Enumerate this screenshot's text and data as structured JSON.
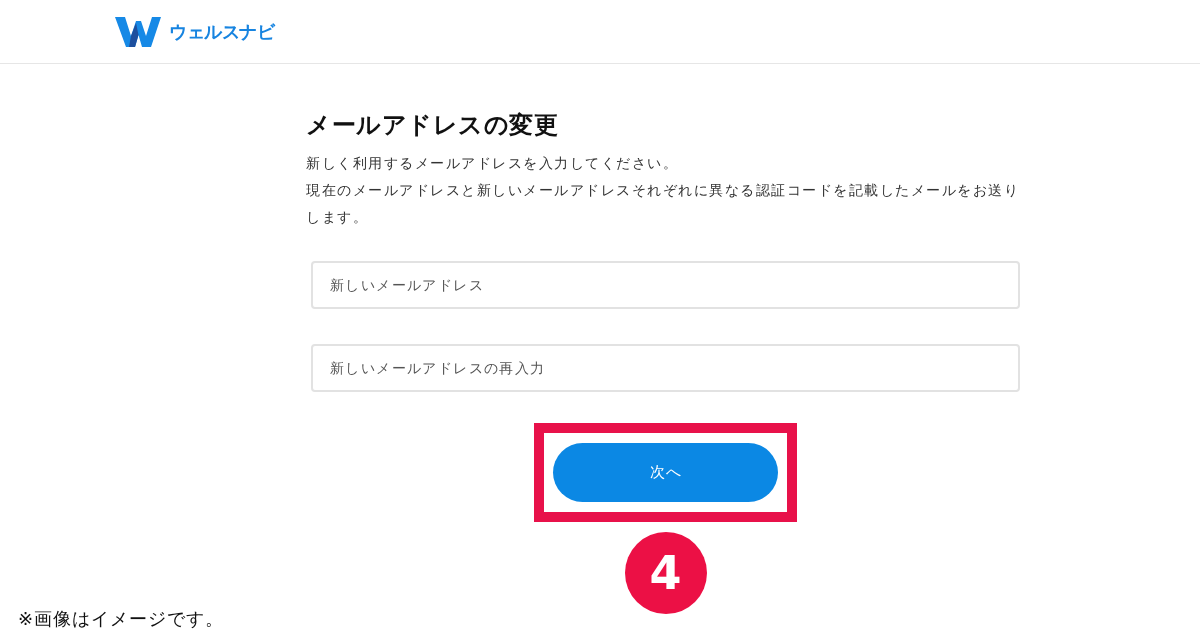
{
  "header": {
    "logo_text": "ウェルスナビ"
  },
  "form": {
    "title": "メールアドレスの変更",
    "description": [
      "新しく利用するメールアドレスを入力してください。",
      "現在のメールアドレスと新しいメールアドレスそれぞれに異なる認証コードを記載したメールをお送りします。"
    ],
    "fields": [
      {
        "placeholder": "新しいメールアドレス"
      },
      {
        "placeholder": "新しいメールアドレスの再入力"
      }
    ],
    "next_button": {
      "label": "次へ",
      "highlighted": true
    }
  },
  "step_number": "4",
  "footnote": "※画像はイメージです。"
}
